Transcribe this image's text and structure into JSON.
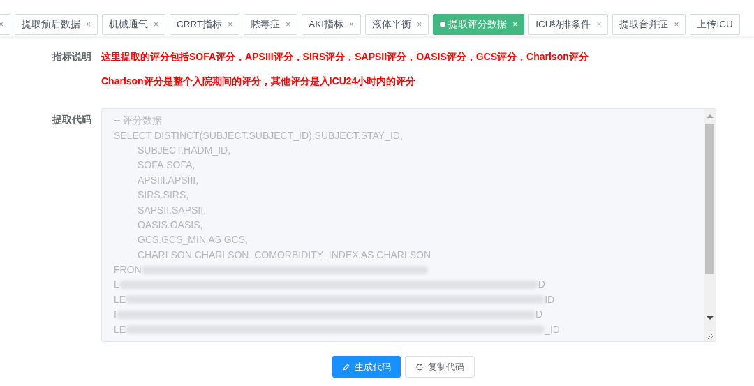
{
  "tabs": [
    {
      "close": "×",
      "selected": false
    },
    {
      "label": "提取预后数据",
      "close": "×",
      "selected": false
    },
    {
      "label": "机械通气",
      "close": "×",
      "selected": false
    },
    {
      "label": "CRRT指标",
      "close": "×",
      "selected": false
    },
    {
      "label": "脓毒症",
      "close": "×",
      "selected": false
    },
    {
      "label": "AKI指标",
      "close": "×",
      "selected": false
    },
    {
      "label": "液体平衡",
      "close": "×",
      "selected": false
    },
    {
      "label": "提取评分数据",
      "close": "×",
      "selected": true
    },
    {
      "label": "ICU纳排条件",
      "close": "×",
      "selected": false
    },
    {
      "label": "提取合并症",
      "close": "×",
      "selected": false
    },
    {
      "label": "上传ICU",
      "selected": false
    }
  ],
  "description": {
    "label": "指标说明",
    "lines": [
      "这里提取的评分包括SOFA评分，APSIII评分，SIRS评分，SAPSII评分，OASIS评分，GCS评分，Charlson评分",
      "Charlson评分是整个入院期间的评分，其他评分是入ICU24小时内的评分"
    ]
  },
  "code": {
    "label": "提取代码",
    "lines": [
      {
        "text": "-- 评分数据",
        "indent": false
      },
      {
        "text": "SELECT DISTINCT(SUBJECT.SUBJECT_ID),SUBJECT.STAY_ID,",
        "indent": false
      },
      {
        "text": "SUBJECT.HADM_ID,",
        "indent": true
      },
      {
        "text": "SOFA.SOFA,",
        "indent": true
      },
      {
        "text": "APSIII.APSIII,",
        "indent": true
      },
      {
        "text": "SIRS.SIRS,",
        "indent": true
      },
      {
        "text": "SAPSII.SAPSII,",
        "indent": true
      },
      {
        "text": "OASIS.OASIS,",
        "indent": true
      },
      {
        "text": "GCS.GCS_MIN AS GCS,",
        "indent": true
      },
      {
        "text": "CHARLSON.CHARLSON_COMORBIDITY_INDEX AS CHARLSON",
        "indent": true
      },
      {
        "text": "FRON",
        "indent": false,
        "blurred": true
      },
      {
        "text": "L",
        "indent": false,
        "blurred": true,
        "blur_end": "D"
      },
      {
        "text": "LE",
        "indent": false,
        "blurred": true,
        "blur_end": "ID"
      },
      {
        "text": "I",
        "indent": false,
        "blurred": true,
        "blur_end": "D"
      },
      {
        "text": "LE",
        "indent": false,
        "blurred": true,
        "blur_end": "_ID"
      }
    ]
  },
  "buttons": [
    {
      "label": "生成代码",
      "kind": "primary"
    },
    {
      "label": "复制代码",
      "kind": "default"
    }
  ]
}
